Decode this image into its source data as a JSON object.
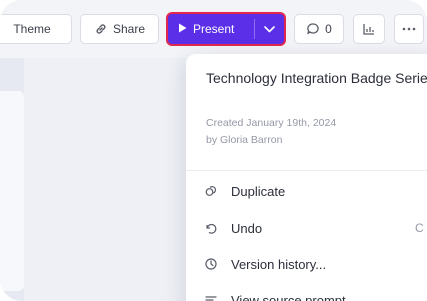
{
  "toolbar": {
    "theme_label": "Theme",
    "share_label": "Share",
    "present_label": "Present",
    "comment_count": "0"
  },
  "menu": {
    "title": "Technology Integration Badge Series",
    "created": "Created January 19th, 2024",
    "author": "by Gloria Barron",
    "items": [
      {
        "label": "Duplicate",
        "icon": "duplicate-icon",
        "shortcut": ""
      },
      {
        "label": "Undo",
        "icon": "undo-icon",
        "shortcut": "C"
      },
      {
        "label": "Version history...",
        "icon": "history-icon",
        "shortcut": ""
      },
      {
        "label": "View source prompt",
        "icon": "source-prompt-icon",
        "shortcut": ""
      }
    ]
  },
  "colors": {
    "present_bg": "#5b2fe8",
    "present_outline": "#e0284f",
    "toolbar_bg": "#f3f4f8"
  }
}
